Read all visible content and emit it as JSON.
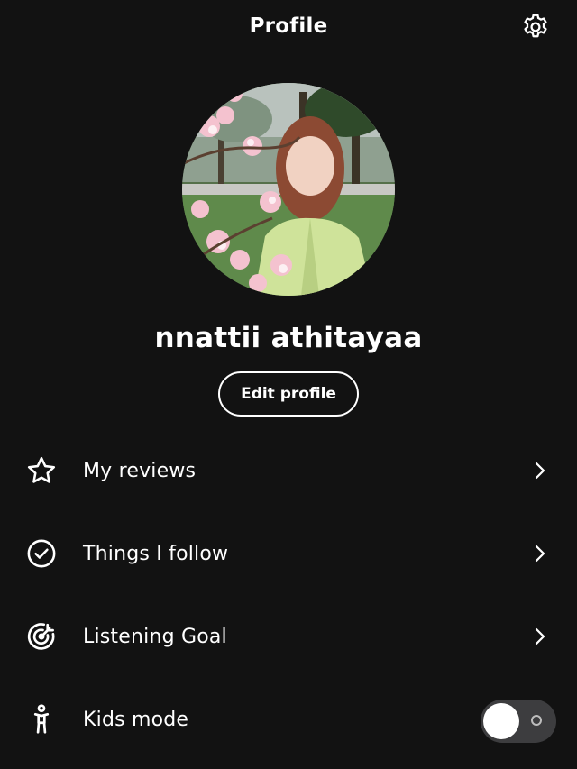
{
  "header": {
    "title": "Profile",
    "settings_icon": "gear-icon"
  },
  "profile": {
    "username": "nnattii athitayaa",
    "edit_label": "Edit profile"
  },
  "menu": {
    "items": [
      {
        "label": "My reviews",
        "icon": "star-icon",
        "trailing": "chevron-right-icon"
      },
      {
        "label": "Things I follow",
        "icon": "check-circle-icon",
        "trailing": "chevron-right-icon"
      },
      {
        "label": "Listening Goal",
        "icon": "target-icon",
        "trailing": "chevron-right-icon"
      },
      {
        "label": "Kids mode",
        "icon": "child-icon",
        "trailing": "toggle",
        "toggle_on": false
      }
    ]
  },
  "colors": {
    "background": "#121212",
    "text": "#ffffff",
    "toggle_track": "#3d3d3f"
  }
}
